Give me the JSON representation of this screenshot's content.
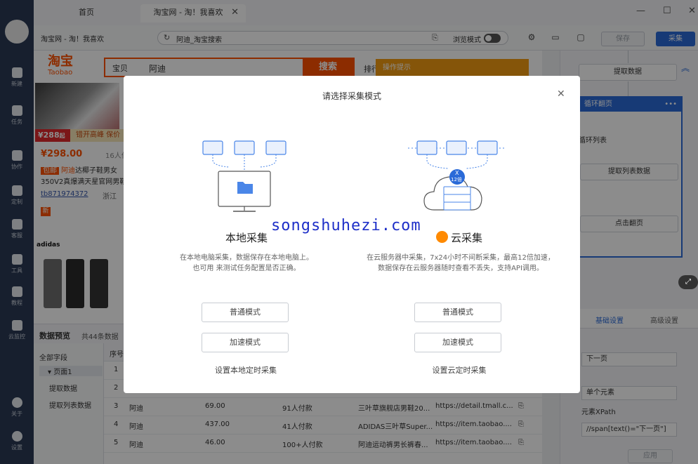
{
  "sidebar": {
    "items": [
      {
        "label": "新建",
        "icon": "plus-icon"
      },
      {
        "label": "任务",
        "icon": "bookmark-icon"
      },
      {
        "label": "协作",
        "icon": "users-icon"
      },
      {
        "label": "定制",
        "icon": "heart-icon"
      },
      {
        "label": "客服",
        "icon": "headset-icon"
      },
      {
        "label": "工具",
        "icon": "briefcase-icon"
      },
      {
        "label": "教程",
        "icon": "book-icon"
      },
      {
        "label": "云监控",
        "icon": "cloud-monitor-icon"
      }
    ],
    "bottom": [
      {
        "label": "关于",
        "icon": "info-icon"
      },
      {
        "label": "设置",
        "icon": "settings-icon"
      }
    ]
  },
  "tabs": [
    {
      "label": "首页"
    },
    {
      "label": "淘宝网 - 淘！我喜欢"
    }
  ],
  "toolbar": {
    "page_title": "淘宝网 - 淘！我喜欢",
    "url": "阿迪_淘宝搜索",
    "browse_mode_label": "浏览模式",
    "save_label": "保存",
    "collect_label": "采集"
  },
  "taobao": {
    "logo": "淘宝",
    "logo_sub": "Taobao",
    "search_category": "宝贝",
    "search_query": "阿迪",
    "search_button": "搜索",
    "sort_label": "排行",
    "hint_label": "操作提示",
    "product1": {
      "badge_price": "¥288",
      "badge_unit": "起",
      "promo": "错开高峰 保价",
      "price": "¥298.00",
      "paid": "16人付",
      "tag": "包邮",
      "keyword": "阿迪",
      "title_rest": "达椰子鞋男女",
      "title_line2": "350V2真爆满天星官网男鞋",
      "seller": "tb871974372",
      "location": "浙江",
      "new_tag": "新"
    },
    "brand": "adidas"
  },
  "preview": {
    "title": "数据预览",
    "count": "共44条数据"
  },
  "fields_panel": {
    "all_fields": "全部字段",
    "page1": "页面1",
    "extract_data": "提取数据",
    "extract_list": "提取列表数据"
  },
  "grid": {
    "header_index": "序号",
    "rows": [
      {
        "index": "1",
        "name": "",
        "price": "",
        "paid": "",
        "title": "",
        "link": ""
      },
      {
        "index": "2",
        "name": "",
        "price": "",
        "paid": "",
        "title": "",
        "link": ""
      },
      {
        "index": "3",
        "name": "阿迪",
        "price": "69.00",
        "paid": "91人付款",
        "title": "三叶草旗舰店男鞋20...",
        "link": "https://detail.tmall.c..."
      },
      {
        "index": "4",
        "name": "阿迪",
        "price": "437.00",
        "paid": "41人付款",
        "title": "ADIDAS三叶草Super...",
        "link": "https://item.taobao...."
      },
      {
        "index": "5",
        "name": "阿迪",
        "price": "46.00",
        "paid": "100+人付款",
        "title": "阿迪运动裤男长裤春...",
        "link": "https://item.taobao...."
      }
    ]
  },
  "workflow": {
    "extract_data": "提取数据",
    "loop_page": "循环翻页",
    "loop_list": "循环列表",
    "extract_list": "提取列表数据",
    "click_page": "点击翻页"
  },
  "settings": {
    "tab_basic": "基础设置",
    "tab_advanced": "高级设置",
    "field_value": "下一页",
    "select_value": "单个元素",
    "xpath_label": "元素XPath",
    "xpath_value": "//span[text()=\"下一页\"]",
    "apply_label": "应用"
  },
  "modal": {
    "title": "请选择采集模式",
    "local": {
      "title": "本地采集",
      "desc_line1": "在本地电脑采集，数据保存在本地电脑上。",
      "desc_line2": "也可用 来测试任务配置是否正确。",
      "normal_btn": "普通模式",
      "fast_btn": "加速模式",
      "schedule_link": "设置本地定时采集"
    },
    "cloud": {
      "title": "云采集",
      "desc_line1": "在云服务器中采集，7x24小时不间断采集，最高12倍加速，",
      "desc_line2": "数据保存在云服务器随时查看不丢失，支持API调用。",
      "normal_btn": "普通模式",
      "fast_btn": "加速模式",
      "schedule_link": "设置云定时采集",
      "speed_badge": "X",
      "speed_badge2": "12倍"
    }
  },
  "watermark": "songshuhezi.com",
  "colors": {
    "sidebar": "#2b3a55",
    "accent": "#2a6ad8",
    "taobao_orange": "#ff5000",
    "hint_orange": "#f39c12"
  }
}
